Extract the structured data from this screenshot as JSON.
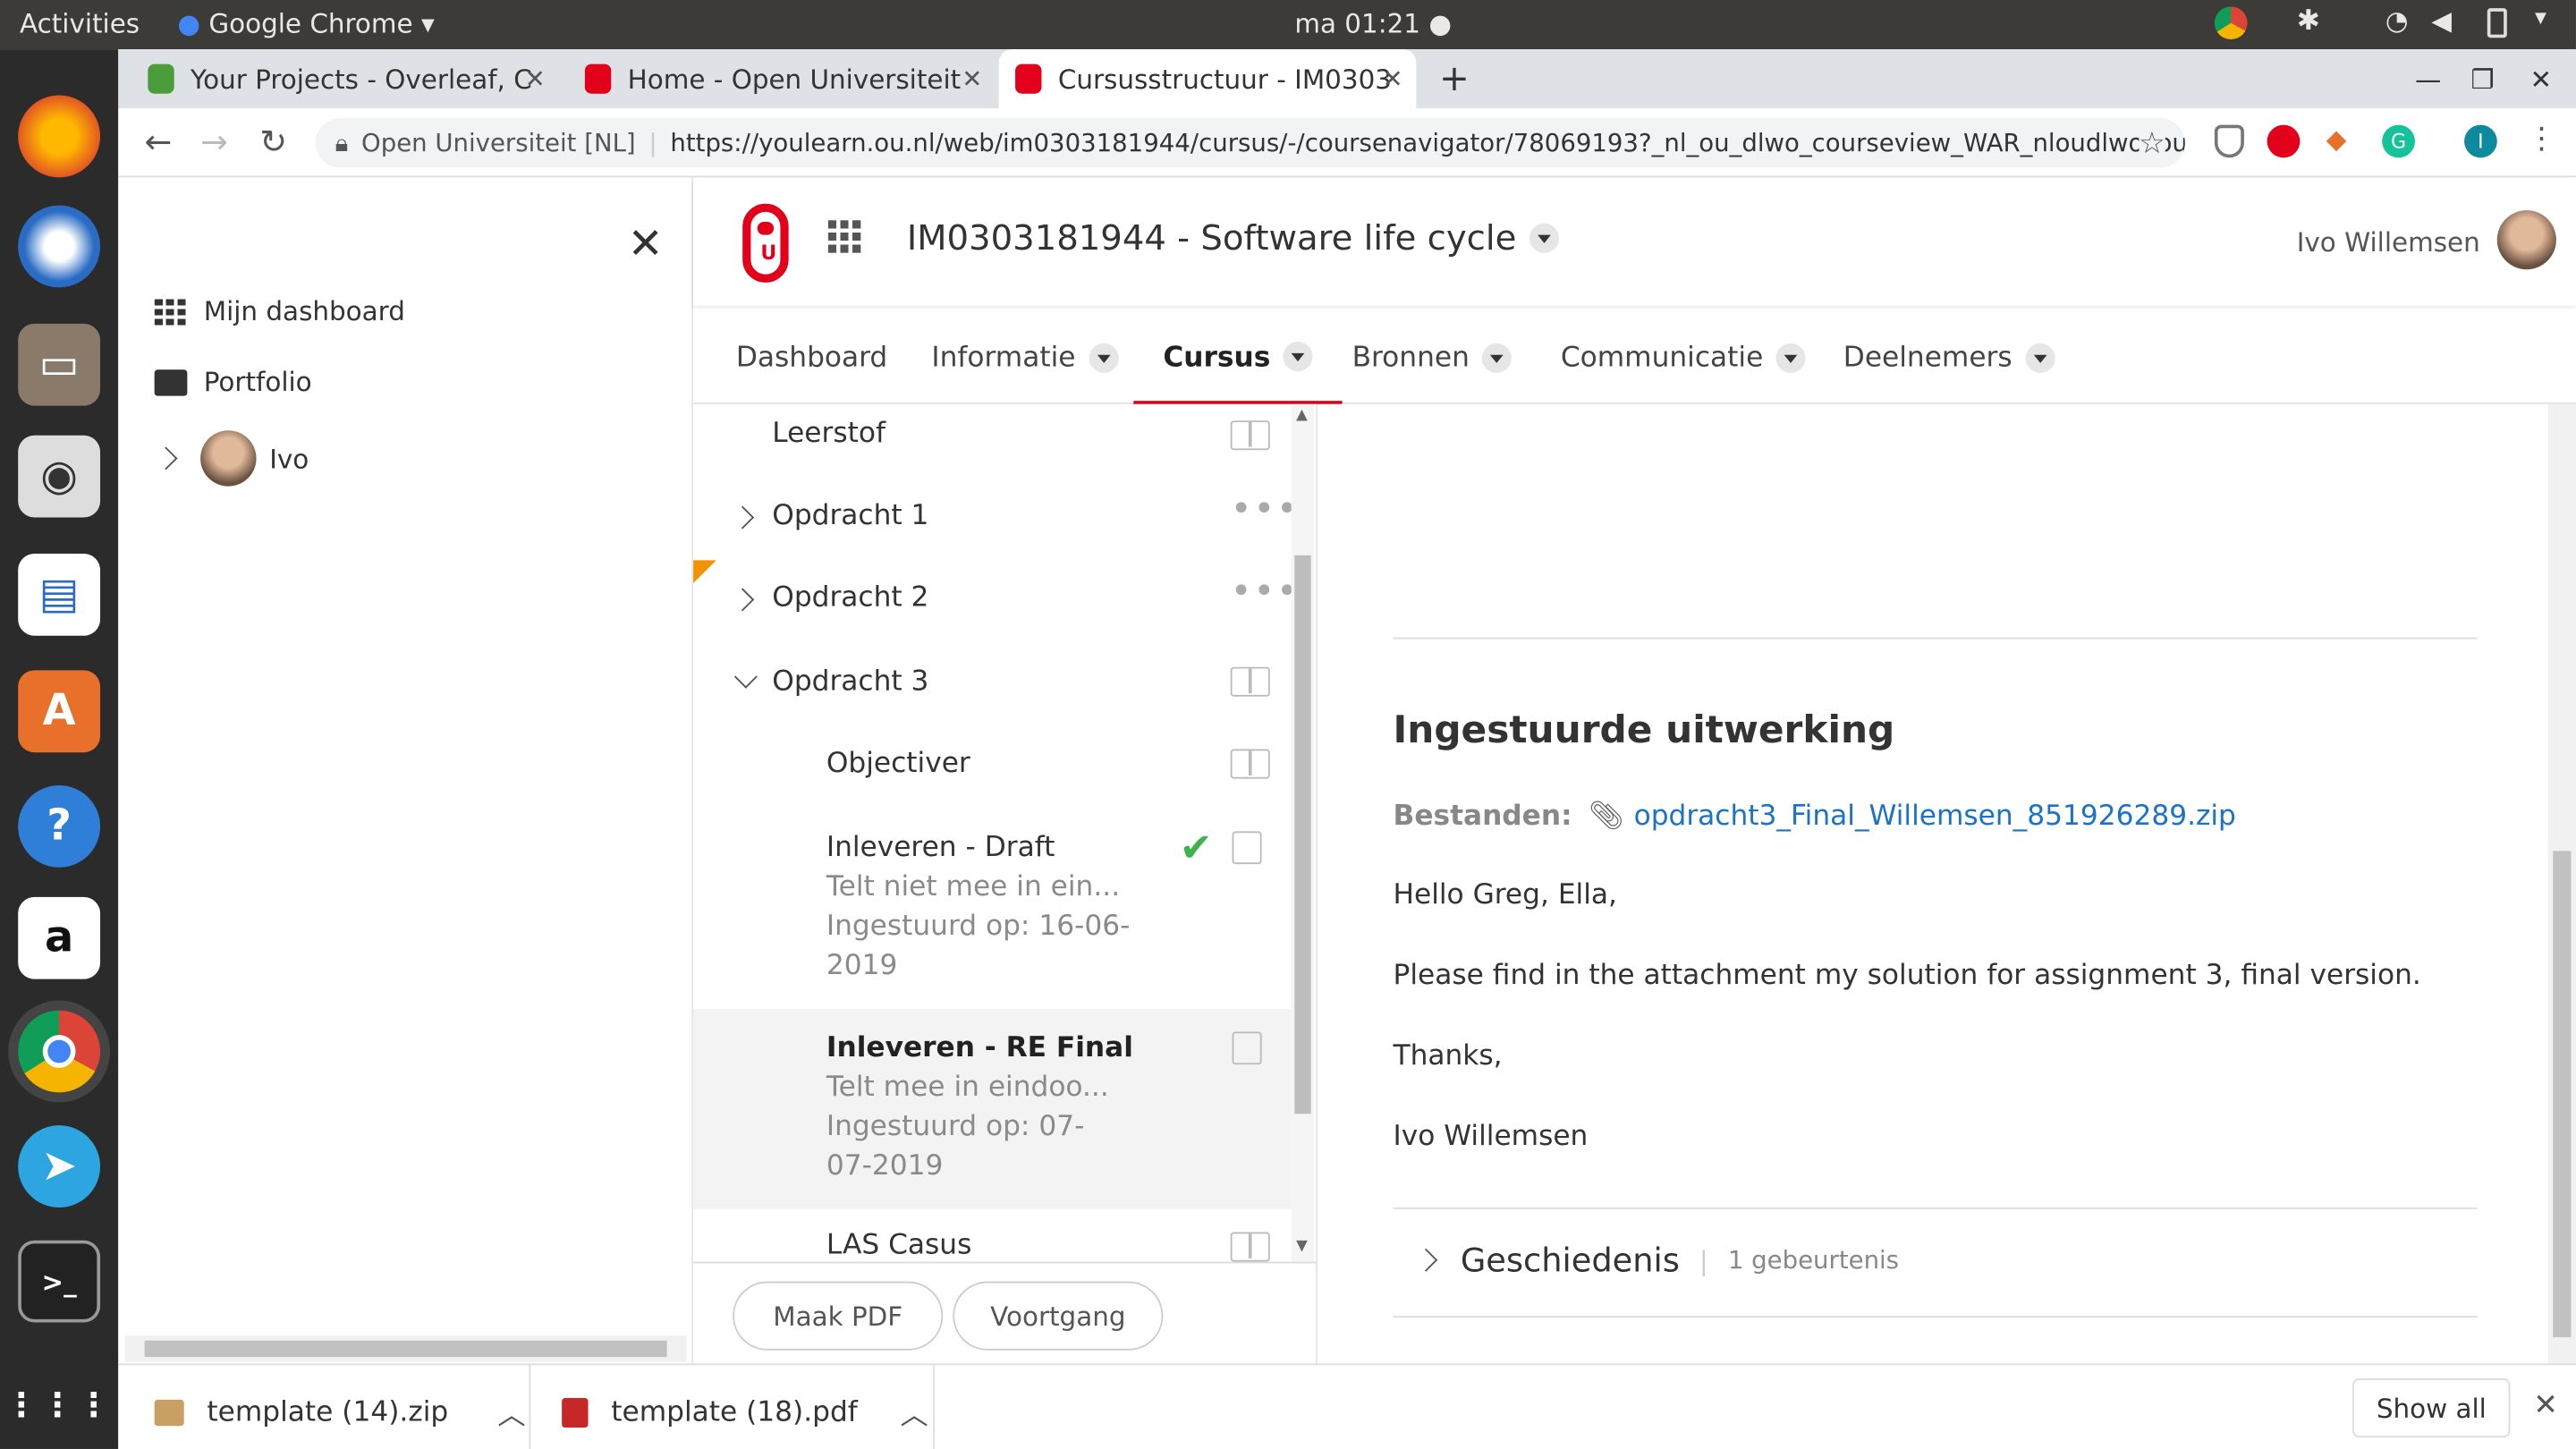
{
  "topbar": {
    "activities": "Activities",
    "app": "Google Chrome",
    "clock": "ma 01:21"
  },
  "tabs": [
    {
      "title": "Your Projects - Overleaf, C",
      "color": "#4b9c3b"
    },
    {
      "title": "Home - Open Universiteit",
      "color": "#e3001b"
    },
    {
      "title": "Cursusstructuur - IM0303",
      "color": "#e3001b"
    }
  ],
  "address": {
    "site": "Open Universiteit [NL]",
    "url": "https://youlearn.ou.nl/web/im0303181944/cursus/-/coursenavigator/78069193?_nl_ou_dlwo_courseview_WAR_nloudlwocour..."
  },
  "side": {
    "dashboard": "Mijn dashboard",
    "portfolio": "Portfolio",
    "user": "Ivo"
  },
  "header": {
    "course": "IM0303181944 - Software life cycle",
    "username": "Ivo Willemsen"
  },
  "nav": [
    "Dashboard",
    "Informatie",
    "Cursus",
    "Bronnen",
    "Communicatie",
    "Deelnemers"
  ],
  "tree": {
    "leerstof": "Leerstof",
    "op1": "Opdracht 1",
    "op2": "Opdracht 2",
    "op3": "Opdracht 3",
    "objectiver": "Objectiver",
    "draft": {
      "title": "Inleveren - Draft",
      "line1": "Telt niet mee in ein...",
      "line2": "Ingestuurd op: 16-06-",
      "line3": "2019"
    },
    "final": {
      "title": "Inleveren - RE Final",
      "line1": "Telt mee in eindoo...",
      "line2": "Ingestuurd op: 07-",
      "line3": "07-2019"
    },
    "las": "LAS Casus"
  },
  "buttons": {
    "pdf": "Maak PDF",
    "progress": "Voortgang"
  },
  "content": {
    "heading": "Ingestuurde uitwerking",
    "files_label": "Bestanden:",
    "file": "opdracht3_Final_Willemsen_851926289.zip",
    "p1": "Hello Greg, Ella,",
    "p2": "Please find in the attachment my solution for assignment 3, final version.",
    "p3": "Thanks,",
    "p4": "Ivo Willemsen",
    "history": "Geschiedenis",
    "history_count": "1 gebeurtenis"
  },
  "downloads": [
    {
      "name": "template (14).zip"
    },
    {
      "name": "template (18).pdf"
    }
  ],
  "show_all": "Show all",
  "colors": {
    "ou_red": "#e3001b",
    "link": "#1a73c9",
    "check": "#3cb44b"
  }
}
